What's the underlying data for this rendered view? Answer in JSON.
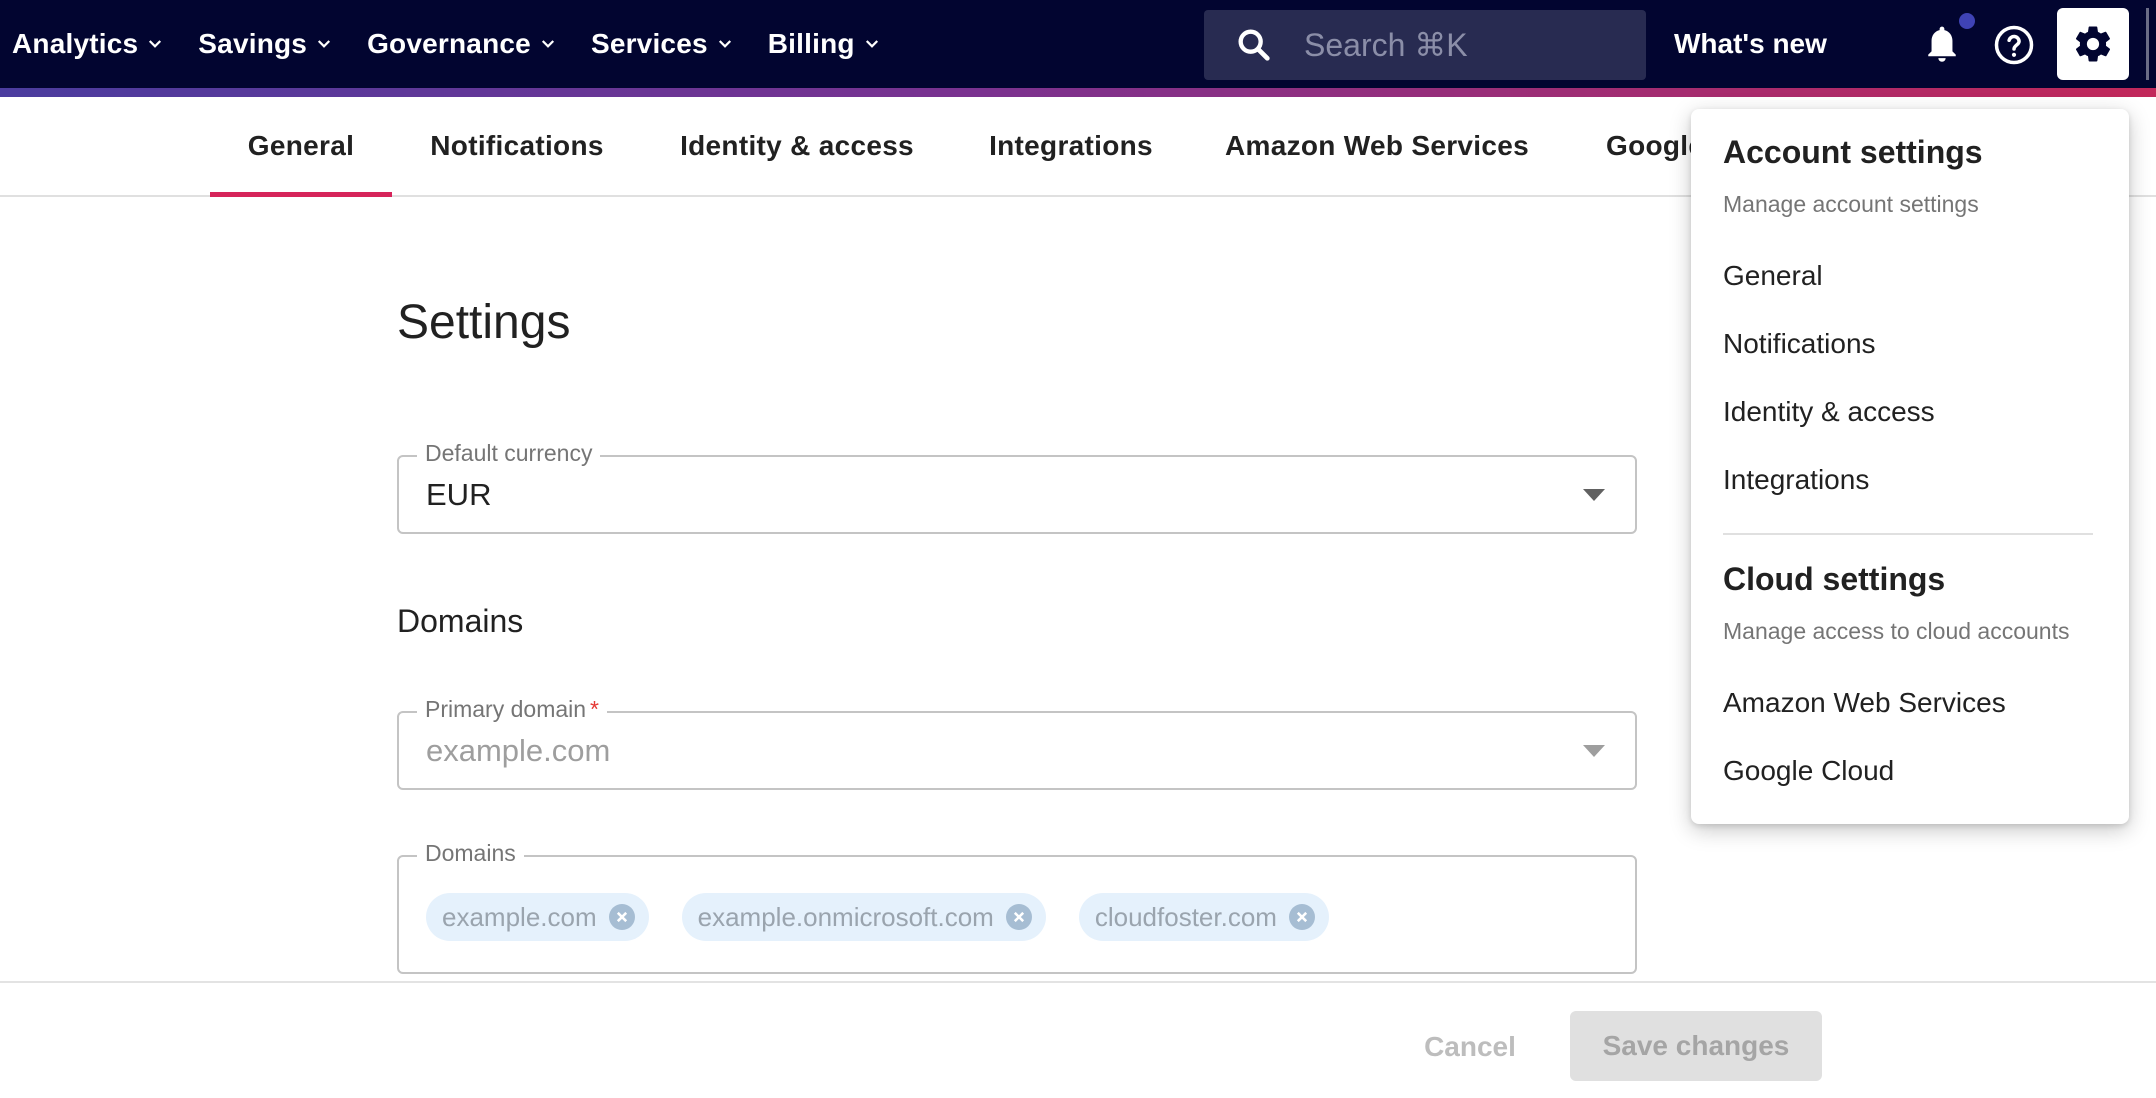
{
  "topnav": {
    "menu": [
      {
        "label": "Analytics",
        "icon": "chevron-down-icon"
      },
      {
        "label": "Savings",
        "icon": "chevron-down-icon"
      },
      {
        "label": "Governance",
        "icon": "chevron-down-icon"
      },
      {
        "label": "Services",
        "icon": "chevron-down-icon"
      },
      {
        "label": "Billing",
        "icon": "chevron-down-icon"
      }
    ],
    "search_placeholder": "Search ⌘K",
    "whats_new": "What's new",
    "icons": [
      "search-icon",
      "bell-icon",
      "help-icon",
      "gear-icon"
    ],
    "notification_dot": true
  },
  "tabs": [
    {
      "label": "General",
      "active": true
    },
    {
      "label": "Notifications",
      "active": false
    },
    {
      "label": "Identity & access",
      "active": false
    },
    {
      "label": "Integrations",
      "active": false
    },
    {
      "label": "Amazon Web Services",
      "active": false
    },
    {
      "label": "Google",
      "active": false
    }
  ],
  "page": {
    "title": "Settings",
    "currency": {
      "label": "Default currency",
      "value": "EUR"
    },
    "domains_heading": "Domains",
    "primary_domain": {
      "label": "Primary domain",
      "required_mark": "*",
      "placeholder": "example.com"
    },
    "domains_field": {
      "label": "Domains",
      "chips": [
        "example.com",
        "example.onmicrosoft.com",
        "cloudfoster.com"
      ]
    }
  },
  "footer": {
    "cancel": "Cancel",
    "save": "Save changes"
  },
  "dropdown": {
    "account": {
      "heading": "Account settings",
      "subtitle": "Manage account settings",
      "items": [
        "General",
        "Notifications",
        "Identity & access",
        "Integrations"
      ]
    },
    "cloud": {
      "heading": "Cloud settings",
      "subtitle": "Manage access to cloud accounts",
      "items": [
        "Amazon Web Services",
        "Google Cloud"
      ]
    }
  },
  "colors": {
    "nav_bg": "#020530",
    "accent": "#d6245a",
    "chip_bg": "#e5f1fc"
  }
}
